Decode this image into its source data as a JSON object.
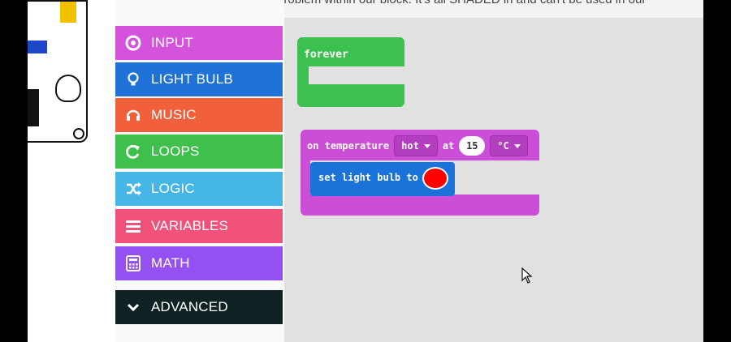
{
  "banner": {
    "text": "still have a problem within our block. It's all SHADED in and can't be used in our"
  },
  "toolbox": {
    "items": [
      {
        "label": "INPUT",
        "color": "#d452dc",
        "icon": "circle-dot-icon"
      },
      {
        "label": "LIGHT BULB",
        "color": "#1f73d8",
        "icon": "lightbulb-icon"
      },
      {
        "label": "MUSIC",
        "color": "#f1603b",
        "icon": "headphones-icon"
      },
      {
        "label": "LOOPS",
        "color": "#3fbf4b",
        "icon": "refresh-icon"
      },
      {
        "label": "LOGIC",
        "color": "#46b6e6",
        "icon": "shuffle-icon"
      },
      {
        "label": "VARIABLES",
        "color": "#f2527a",
        "icon": "list-icon"
      },
      {
        "label": "MATH",
        "color": "#9450f0",
        "icon": "calculator-icon"
      },
      {
        "label": "ADVANCED",
        "color": "#0f2324",
        "icon": "chevron-down-icon"
      }
    ]
  },
  "workspace": {
    "forever_block": {
      "label": "forever",
      "color": "#3cc04f"
    },
    "temperature_block": {
      "prefix": "on temperature",
      "condition": "hot",
      "at_label": "at",
      "value": "15",
      "unit": "°C",
      "color": "#cb4fd6"
    },
    "light_bulb_block": {
      "label": "set light bulb to",
      "color_value": "#ff0000",
      "color": "#1b73d9"
    }
  }
}
